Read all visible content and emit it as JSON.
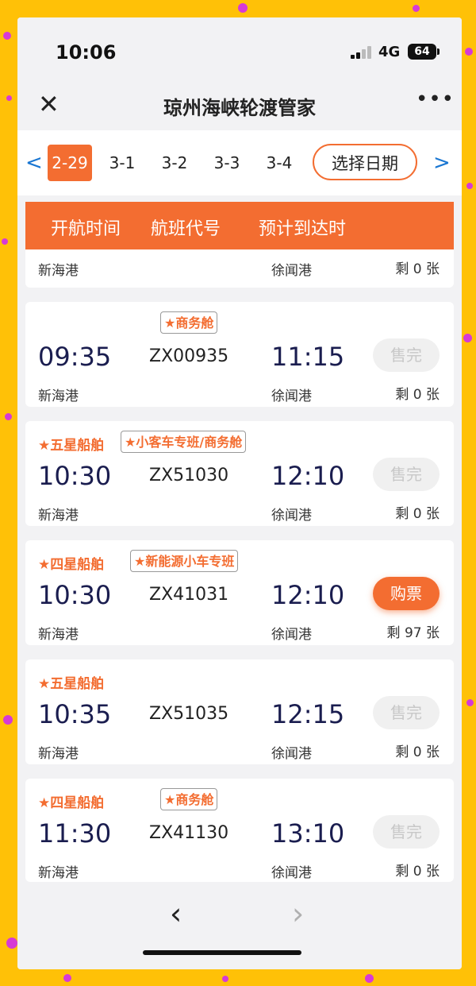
{
  "status_bar": {
    "time": "10:06",
    "network": "4G",
    "battery": "64"
  },
  "header": {
    "title": "琼州海峡轮渡管家",
    "more": "•••"
  },
  "date_bar": {
    "prev_arrow": "<",
    "next_arrow": ">",
    "dates": [
      "2-29",
      "3-1",
      "3-2",
      "3-3",
      "3-4"
    ],
    "selected": "2-29",
    "pick_date_label": "选择日期"
  },
  "table_header": {
    "depart": "开航时间",
    "code": "航班代号",
    "arrive": "预计到达时"
  },
  "partial_row": {
    "from": "新海港",
    "to": "徐闻港",
    "remain": "剩 0 张"
  },
  "sailings": [
    {
      "tag": "",
      "badge": "★商务舱",
      "depart": "09:35",
      "code": "ZX00935",
      "arrive": "11:15",
      "from": "新海港",
      "to": "徐闻港",
      "remain": "剩 0 张",
      "button": "售完",
      "available": false
    },
    {
      "tag": "★五星船舶",
      "badge": "★小客车专班/商务舱",
      "depart": "10:30",
      "code": "ZX51030",
      "arrive": "12:10",
      "from": "新海港",
      "to": "徐闻港",
      "remain": "剩 0 张",
      "button": "售完",
      "available": false
    },
    {
      "tag": "★四星船舶",
      "badge": "★新能源小车专班",
      "depart": "10:30",
      "code": "ZX41031",
      "arrive": "12:10",
      "from": "新海港",
      "to": "徐闻港",
      "remain": "剩 97 张",
      "button": "购票",
      "available": true
    },
    {
      "tag": "★五星船舶",
      "badge": "",
      "depart": "10:35",
      "code": "ZX51035",
      "arrive": "12:15",
      "from": "新海港",
      "to": "徐闻港",
      "remain": "剩 0 张",
      "button": "售完",
      "available": false
    },
    {
      "tag": "★四星船舶",
      "badge": "★商务舱",
      "depart": "11:30",
      "code": "ZX41130",
      "arrive": "13:10",
      "from": "新海港",
      "to": "徐闻港",
      "remain": "剩 0 张",
      "button": "售完",
      "available": false
    }
  ],
  "bottom_nav": {
    "back": "‹",
    "forward": "›"
  },
  "colors": {
    "accent": "#f36d31",
    "link": "#1976d2",
    "time_text": "#1a1d4f",
    "background": "#ffc107"
  }
}
